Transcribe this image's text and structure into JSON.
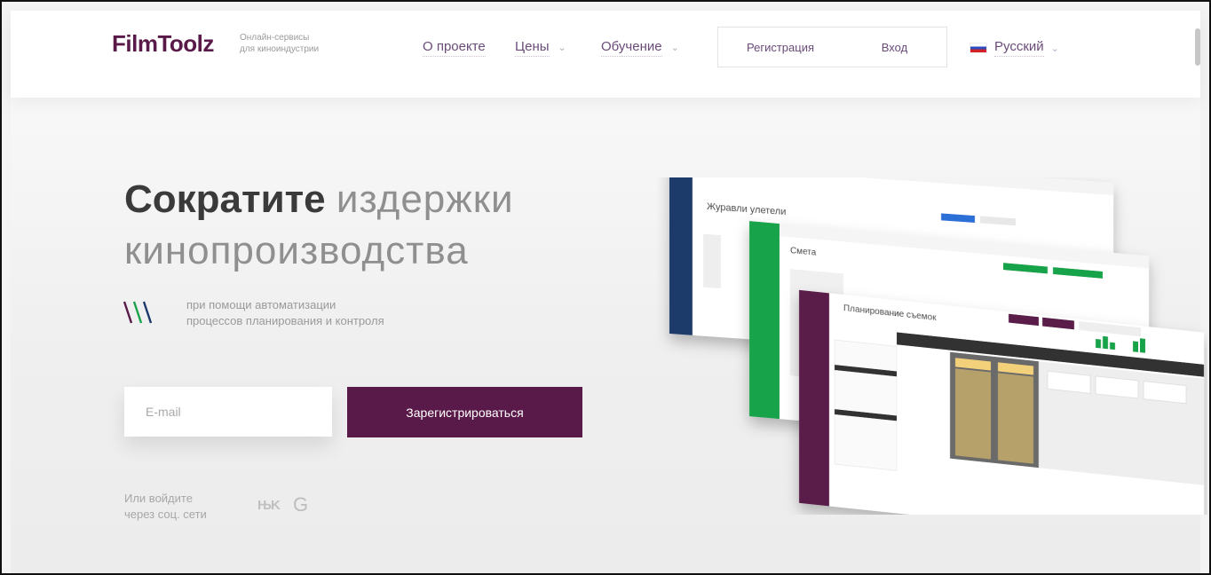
{
  "header": {
    "logo": "FilmToolz",
    "logo_sub_1": "Онлайн-сервисы",
    "logo_sub_2": "для киноиндустрии",
    "nav": [
      "О проекте",
      "Цены",
      "Обучение"
    ],
    "register": "Регистрация",
    "login": "Вход",
    "language": "Русский"
  },
  "hero": {
    "headline_strong": "Сократите",
    "headline_light_1": "издержки",
    "headline_light_2": "кинопроизводства",
    "sub_1": "при помощи автоматизации",
    "sub_2": "процессов планирования и контроля",
    "email_placeholder": "E-mail",
    "cta": "Зарегистрироваться",
    "social_1": "Или войдите",
    "social_2": "через соц. сети",
    "vk": "VK",
    "google": "G"
  },
  "mockups": {
    "back_title": "Журавли улетели",
    "mid_title": "Смета",
    "front_title": "Планирование съемок"
  },
  "colors": {
    "brand": "#5a1a49",
    "accent_green": "#19a34a",
    "app_dark": "#1b3a6b"
  }
}
